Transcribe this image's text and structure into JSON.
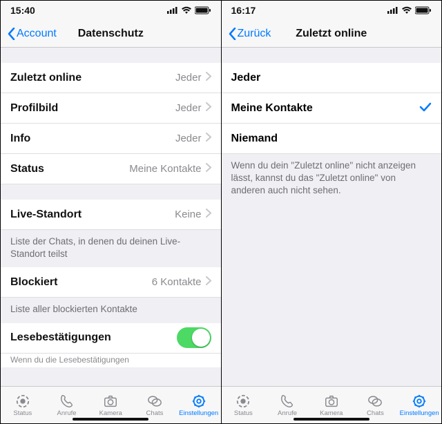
{
  "left": {
    "status_time": "15:40",
    "nav_back": "Account",
    "nav_title": "Datenschutz",
    "rows": {
      "last_seen": {
        "label": "Zuletzt online",
        "value": "Jeder"
      },
      "profile": {
        "label": "Profilbild",
        "value": "Jeder"
      },
      "info": {
        "label": "Info",
        "value": "Jeder"
      },
      "status": {
        "label": "Status",
        "value": "Meine Kontakte"
      },
      "live_loc": {
        "label": "Live-Standort",
        "value": "Keine"
      },
      "blocked": {
        "label": "Blockiert",
        "value": "6 Kontakte"
      },
      "read_rec": {
        "label": "Lesebestätigungen"
      }
    },
    "notes": {
      "live_loc": "Liste der Chats, in denen du deinen Live-Standort teilst",
      "blocked": "Liste aller blockierten Kontakte",
      "read_rec_cut": "Wenn du die Lesebestätigungen"
    }
  },
  "right": {
    "status_time": "16:17",
    "nav_back": "Zurück",
    "nav_title": "Zuletzt online",
    "options": {
      "everyone": "Jeder",
      "contacts": "Meine Kontakte",
      "nobody": "Niemand"
    },
    "selected": "contacts",
    "note": "Wenn du dein \"Zuletzt online\" nicht anzeigen lässt, kannst du das \"Zuletzt online\" von anderen auch nicht sehen."
  },
  "tabs": {
    "status": "Status",
    "calls": "Anrufe",
    "camera": "Kamera",
    "chats": "Chats",
    "settings": "Einstellungen"
  }
}
